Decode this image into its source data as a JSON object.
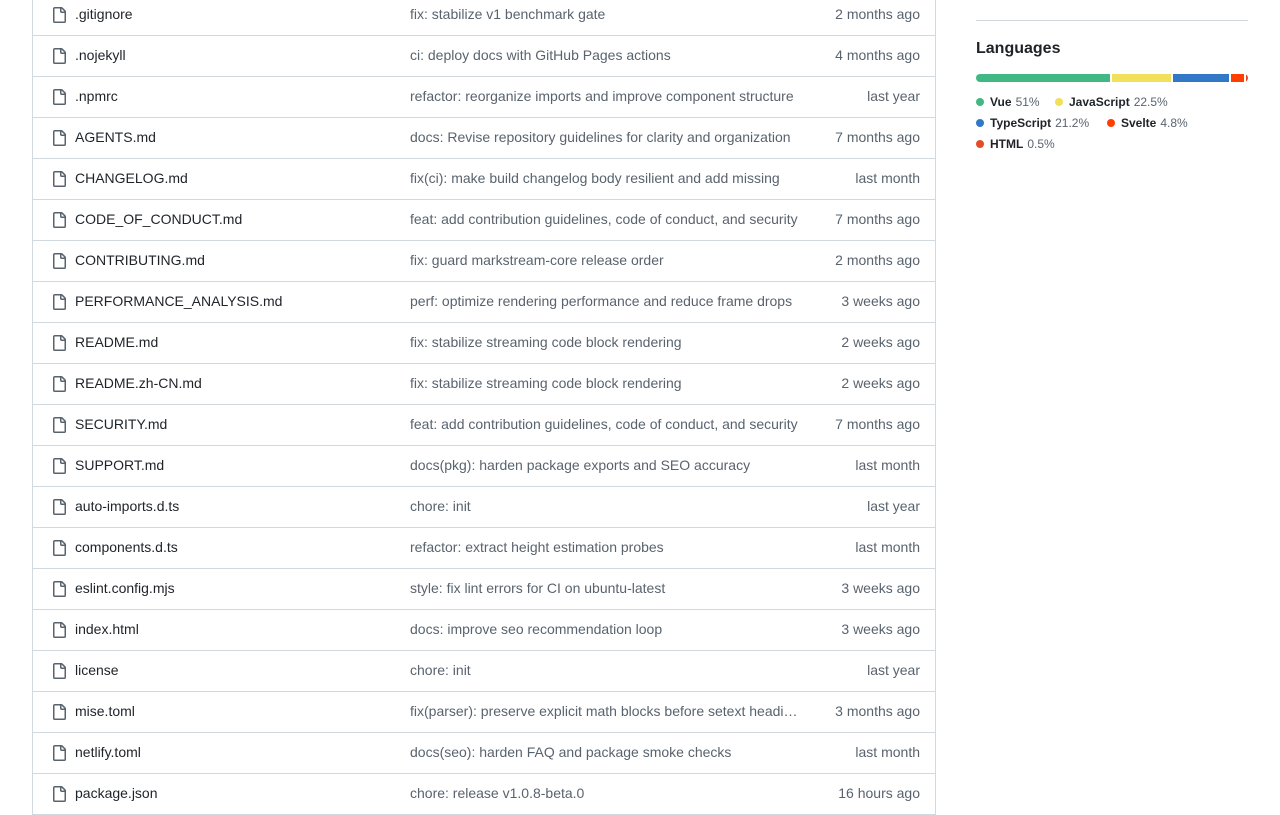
{
  "files": [
    {
      "name": ".gitignore",
      "message": "fix: stabilize v1 benchmark gate",
      "date": "2 months ago"
    },
    {
      "name": ".nojekyll",
      "message": "ci: deploy docs with GitHub Pages actions",
      "date": "4 months ago"
    },
    {
      "name": ".npmrc",
      "message": "refactor: reorganize imports and improve component structure",
      "date": "last year"
    },
    {
      "name": "AGENTS.md",
      "message": "docs: Revise repository guidelines for clarity and organization",
      "date": "7 months ago"
    },
    {
      "name": "CHANGELOG.md",
      "message": "fix(ci): make build changelog body resilient and add missing",
      "date": "last month"
    },
    {
      "name": "CODE_OF_CONDUCT.md",
      "message": "feat: add contribution guidelines, code of conduct, and security",
      "date": "7 months ago"
    },
    {
      "name": "CONTRIBUTING.md",
      "message": "fix: guard markstream-core release order",
      "date": "2 months ago"
    },
    {
      "name": "PERFORMANCE_ANALYSIS.md",
      "message": "perf: optimize rendering performance and reduce frame drops",
      "date": "3 weeks ago"
    },
    {
      "name": "README.md",
      "message": "fix: stabilize streaming code block rendering",
      "date": "2 weeks ago"
    },
    {
      "name": "README.zh-CN.md",
      "message": "fix: stabilize streaming code block rendering",
      "date": "2 weeks ago"
    },
    {
      "name": "SECURITY.md",
      "message": "feat: add contribution guidelines, code of conduct, and security",
      "date": "7 months ago"
    },
    {
      "name": "SUPPORT.md",
      "message": "docs(pkg): harden package exports and SEO accuracy",
      "date": "last month"
    },
    {
      "name": "auto-imports.d.ts",
      "message": "chore: init",
      "date": "last year"
    },
    {
      "name": "components.d.ts",
      "message": "refactor: extract height estimation probes",
      "date": "last month"
    },
    {
      "name": "eslint.config.mjs",
      "message": "style: fix lint errors for CI on ubuntu-latest",
      "date": "3 weeks ago"
    },
    {
      "name": "index.html",
      "message": "docs: improve seo recommendation loop",
      "date": "3 weeks ago"
    },
    {
      "name": "license",
      "message": "chore: init",
      "date": "last year"
    },
    {
      "name": "mise.toml",
      "message": "fix(parser): preserve explicit math blocks before setext headings",
      "date": "3 months ago"
    },
    {
      "name": "netlify.toml",
      "message": "docs(seo): harden FAQ and package smoke checks",
      "date": "last month"
    },
    {
      "name": "package.json",
      "message": "chore: release v1.0.8-beta.0",
      "date": "16 hours ago"
    }
  ],
  "file_icon": "file-icon",
  "languages": {
    "title": "Languages",
    "items": [
      {
        "name": "Vue",
        "percent": "51%",
        "value": 51,
        "color": "#41b883"
      },
      {
        "name": "JavaScript",
        "percent": "22.5%",
        "value": 22.5,
        "color": "#f1e05a"
      },
      {
        "name": "TypeScript",
        "percent": "21.2%",
        "value": 21.2,
        "color": "#3178c6"
      },
      {
        "name": "Svelte",
        "percent": "4.8%",
        "value": 4.8,
        "color": "#ff3e00"
      },
      {
        "name": "HTML",
        "percent": "0.5%",
        "value": 0.5,
        "color": "#e34c26"
      }
    ]
  }
}
